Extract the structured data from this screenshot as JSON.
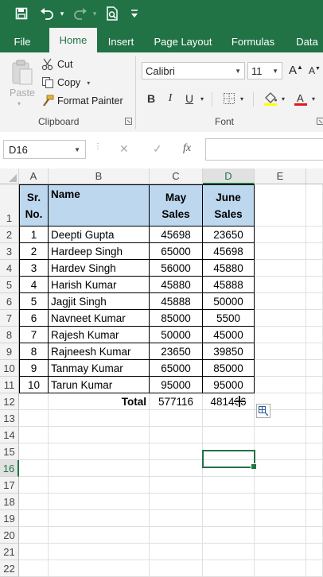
{
  "qat": {
    "save_icon": "save-icon",
    "undo_icon": "undo-icon",
    "redo_icon": "redo-icon",
    "print_preview_icon": "print-preview-icon",
    "customize_icon": "customize-qat-icon"
  },
  "tabs": [
    "File",
    "Home",
    "Insert",
    "Page Layout",
    "Formulas",
    "Data"
  ],
  "active_tab": "Home",
  "clipboard": {
    "paste": "Paste",
    "cut": "Cut",
    "copy": "Copy",
    "format_painter": "Format Painter",
    "group_label": "Clipboard"
  },
  "font": {
    "name": "Calibri",
    "size": "11",
    "group_label": "Font",
    "bold": "B",
    "italic": "I",
    "underline": "U",
    "grow": "A",
    "shrink": "A"
  },
  "formula_bar": {
    "name_box": "D16",
    "cancel": "✕",
    "enter": "✓",
    "fx": "fx",
    "formula": ""
  },
  "columns": [
    "A",
    "B",
    "C",
    "D",
    "E"
  ],
  "selected_column": "D",
  "row_numbers": [
    "1",
    "2",
    "3",
    "4",
    "5",
    "6",
    "7",
    "8",
    "9",
    "10",
    "11",
    "12",
    "13",
    "14",
    "15",
    "16",
    "17",
    "18",
    "19",
    "20",
    "21",
    "22"
  ],
  "selected_row": "16",
  "table": {
    "headers": {
      "sr": "Sr. No.",
      "name": "Name",
      "may": "May Sales",
      "june": "June Sales"
    },
    "rows": [
      {
        "sr": "1",
        "name": "Deepti Gupta",
        "may": "45698",
        "june": "23650"
      },
      {
        "sr": "2",
        "name": "Hardeep Singh",
        "may": "65000",
        "june": "45698"
      },
      {
        "sr": "3",
        "name": "Hardev Singh",
        "may": "56000",
        "june": "45880"
      },
      {
        "sr": "4",
        "name": "Harish Kumar",
        "may": "45880",
        "june": "45888"
      },
      {
        "sr": "5",
        "name": "Jagjit Singh",
        "may": "45888",
        "june": "50000"
      },
      {
        "sr": "6",
        "name": "Navneet Kumar",
        "may": "85000",
        "june": "5500"
      },
      {
        "sr": "7",
        "name": "Rajesh Kumar",
        "may": "50000",
        "june": "45000"
      },
      {
        "sr": "8",
        "name": "Rajneesh Kumar",
        "may": "23650",
        "june": "39850"
      },
      {
        "sr": "9",
        "name": "Tanmay Kumar",
        "may": "65000",
        "june": "85000"
      },
      {
        "sr": "10",
        "name": "Tarun Kumar",
        "may": "95000",
        "june": "95000"
      }
    ],
    "total": {
      "label": "Total",
      "may": "577116",
      "june": "481466"
    }
  },
  "colors": {
    "excel_green": "#217346",
    "header_fill": "#bdd7ee"
  }
}
